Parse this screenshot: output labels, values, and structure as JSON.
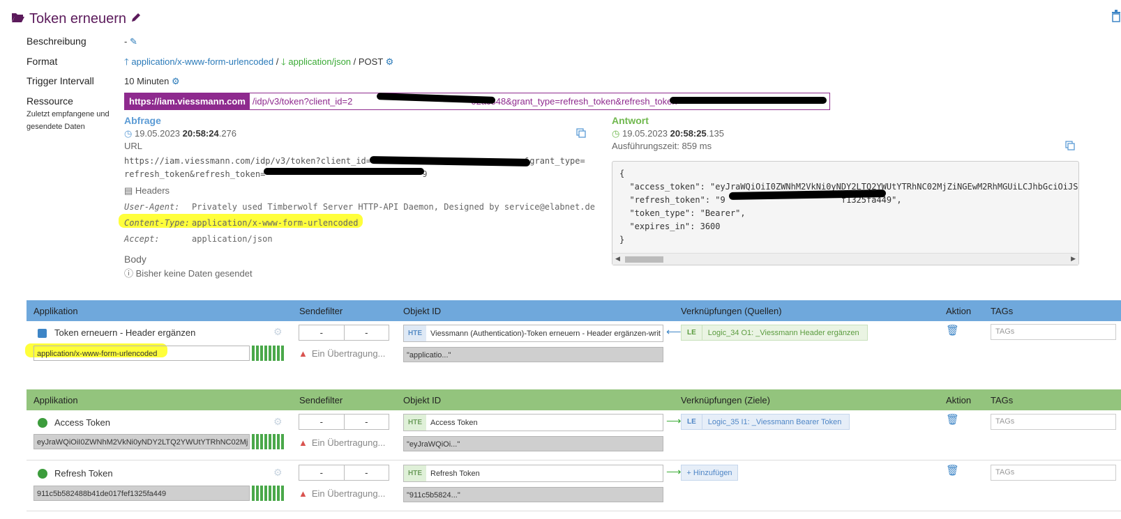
{
  "header": {
    "title": "Token erneuern"
  },
  "fields": {
    "beschreibung_label": "Beschreibung",
    "beschreibung_value": "-",
    "format_label": "Format",
    "format_in": "application/x-www-form-urlencoded",
    "format_sep": "/",
    "format_out": "application/json",
    "format_method": "/ POST",
    "trigger_label": "Trigger Intervall",
    "trigger_value": "10 Minuten",
    "ressource_label": "Ressource",
    "ressource_sub": "Zuletzt empfangene und gesendete Daten",
    "ressource_host": "https://iam.viessmann.com",
    "ressource_path": "/idp/v3/token?client_id=2",
    "ressource_mid": "02ac848&grant_type=refresh_token&refresh_token="
  },
  "request": {
    "title": "Abfrage",
    "date": "19.05.2023",
    "time_bold": "20:58:24",
    "time_ms": ".276",
    "url_label": "URL",
    "url_line1_a": "https://iam.viessmann.com/idp/v3/token?client_id=",
    "url_line1_b": "&grant_type=",
    "url_line2_a": "refresh_token&refresh_token=",
    "url_line2_b": "9",
    "headers_title": "Headers",
    "headers": [
      {
        "key": "User-Agent:",
        "value": "Privately used Timberwolf Server HTTP-API Daemon, Designed by service@elabnet.de"
      },
      {
        "key": "Content-Type:",
        "value": "application/x-www-form-urlencoded"
      },
      {
        "key": "Accept:",
        "value": "application/json"
      }
    ],
    "body_title": "Body",
    "body_value": "Bisher keine Daten gesendet"
  },
  "response": {
    "title": "Antwort",
    "date": "19.05.2023",
    "time_bold": "20:58:25",
    "time_ms": ".135",
    "exec_time": "Ausführungszeit: 859 ms",
    "json_lines": [
      "{",
      "  \"access_token\": \"eyJraWQiOiI0ZWNhM2VkNi0yNDY2LTQ2YWUtYTRhNC02MjZiNGEwM2RhMGUiLCJhbGciOiJSU",
      "  \"refresh_token\": \"9                       f1325fa449\",",
      "  \"token_type\": \"Bearer\",",
      "  \"expires_in\": 3600",
      "}"
    ]
  },
  "table_sources": {
    "headers": [
      "Applikation",
      "Sendefilter",
      "Objekt ID",
      "Verknüpfungen (Quellen)",
      "Aktion",
      "TAGs"
    ],
    "rows": [
      {
        "name": "Token erneuern - Header ergänzen",
        "value": "application/x-www-form-urlencoded",
        "filter_min": "-",
        "filter_max": "-",
        "warning": "Ein Übertragung...",
        "obj_tag": "HTE",
        "obj_name": "Viessmann (Authentication)-Token erneuern - Header ergänzen-writ",
        "obj_value": "\"applicatio...\"",
        "link_tag": "LE",
        "link_name": "Logic_34 O1: _Viessmann Header ergänzen",
        "tags_placeholder": "TAGs"
      }
    ]
  },
  "table_targets": {
    "headers": [
      "Applikation",
      "Sendefilter",
      "Objekt ID",
      "Verknüpfungen (Ziele)",
      "Aktion",
      "TAGs"
    ],
    "rows": [
      {
        "name": "Access Token",
        "value": "eyJraWQiOiI0ZWNhM2VkNi0yNDY2LTQ2YWUtYTRhNC02Mj",
        "filter_min": "-",
        "filter_max": "-",
        "warning": "Ein Übertragung...",
        "obj_tag": "HTE",
        "obj_name": "Access Token",
        "obj_value": "\"eyJraWQiOi...\"",
        "link_tag": "LE",
        "link_name": "Logic_35 I1: _Viessmann Bearer Token",
        "tags_placeholder": "TAGs"
      },
      {
        "name": "Refresh Token",
        "value": "911c5b582488b41de017fef1325fa449",
        "filter_min": "-",
        "filter_max": "-",
        "warning": "Ein Übertragung...",
        "obj_tag": "HTE",
        "obj_name": "Refresh Token",
        "obj_value": "\"911c5b5824...\"",
        "link_add": "+ Hinzufügen",
        "tags_placeholder": "TAGs"
      }
    ]
  }
}
